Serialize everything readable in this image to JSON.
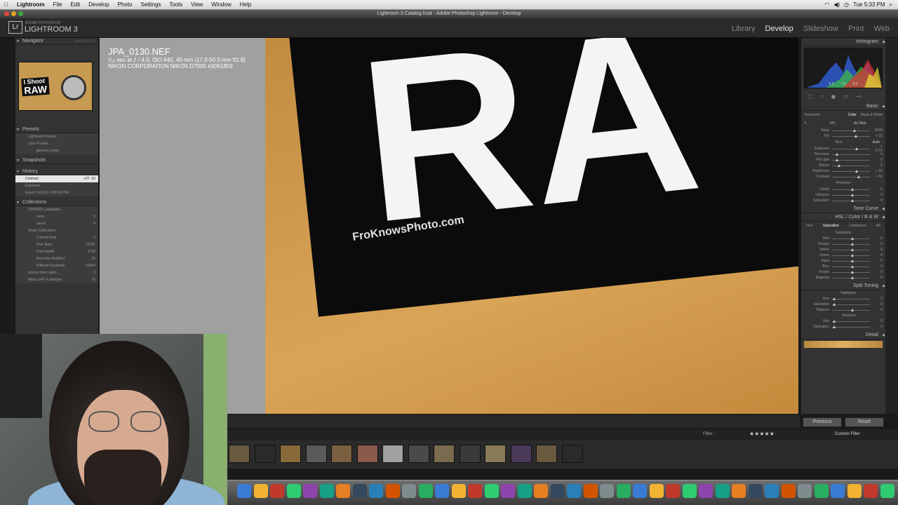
{
  "menubar": {
    "apple": "",
    "items": [
      "Lightroom",
      "File",
      "Edit",
      "Develop",
      "Photo",
      "Settings",
      "Tools",
      "View",
      "Window",
      "Help"
    ],
    "clock": "Tue 5:33 PM"
  },
  "window": {
    "title": "Lightroom 3 Catalog.lrcat - Adobe Photoshop Lightroom - Develop"
  },
  "lr": {
    "logo": "Lr",
    "brand_sub": "ADOBE PHOTOSHOP",
    "brand": "LIGHTROOM 3",
    "modules": [
      "Library",
      "Develop",
      "Slideshow",
      "Print",
      "Web"
    ],
    "active_module": "Develop"
  },
  "left": {
    "navigator": "Navigator",
    "nav_zoom": [
      "FIT",
      "FILL",
      "1:1",
      "3:1"
    ],
    "thumb_text": [
      "I Shoot",
      "RAW"
    ],
    "presets": "Presets",
    "preset_items": [
      "Lightroom Presets",
      "User Presets",
      "general_sharp"
    ],
    "snapshots": "Snapshots",
    "history": "History",
    "history_items": [
      {
        "name": "Contrast",
        "a": "+27",
        "b": "52"
      },
      {
        "name": "Exposure",
        "a": "",
        "b": ""
      },
      {
        "name": "Import (2/16/11 4:08:38 PM)",
        "a": "",
        "b": ""
      }
    ],
    "collections": "Collections",
    "collection_items": [
      {
        "name": "20090822_pasquale...",
        "count": ""
      },
      {
        "name": "Greg",
        "count": "0"
      },
      {
        "name": "Jared",
        "count": "0"
      },
      {
        "name": "Smart Collections",
        "count": ""
      },
      {
        "name": "Colored Red",
        "count": "0"
      },
      {
        "name": "Five Stars",
        "count": "16761"
      },
      {
        "name": "Past Month",
        "count": "1730"
      },
      {
        "name": "Recently Modified",
        "count": "26"
      },
      {
        "name": "Without Keywords",
        "count": "23424"
      },
      {
        "name": "photos from Lightr...",
        "count": "0"
      },
      {
        "name": "Nikon 24f1.4 samples",
        "count": "22"
      }
    ]
  },
  "photo": {
    "filename": "JPA_0130.NEF",
    "exposure": "¹⁄₅₀ sec at ƒ / 4.0, ISO 640, 40 mm (17.0-50.0 mm f/2.8)",
    "camera": "NIKON CORPORATION NIKON D7000 #3061859",
    "letters": "RA",
    "caption": "FroKnowsPhoto.com"
  },
  "right": {
    "histogram": "Histogram",
    "histo_vals": [
      "8.3",
      "7.6",
      "8.5"
    ],
    "basic": "Basic",
    "treatment": "Treatment:",
    "color": "Color",
    "bw": "Black & White",
    "wb": "WB :",
    "wb_val": "As Shot",
    "tone": "Tone",
    "auto": "Auto",
    "presence": "Presence",
    "sliders_basic": [
      {
        "name": "Temp",
        "val": "4600",
        "pos": 0.55
      },
      {
        "name": "Tint",
        "val": "+ 22",
        "pos": 0.6
      }
    ],
    "sliders_tone": [
      {
        "name": "Exposure",
        "val": "+ 0.75",
        "pos": 0.62
      },
      {
        "name": "Recovery",
        "val": "0",
        "pos": 0.1
      },
      {
        "name": "Fill Light",
        "val": "0",
        "pos": 0.1
      },
      {
        "name": "Blacks",
        "val": "5",
        "pos": 0.15
      },
      {
        "name": "Brightness",
        "val": "+ 50",
        "pos": 0.62
      },
      {
        "name": "Contrast",
        "val": "+ 52",
        "pos": 0.66
      }
    ],
    "sliders_presence": [
      {
        "name": "Clarity",
        "val": "0",
        "pos": 0.5
      },
      {
        "name": "Vibrance",
        "val": "0",
        "pos": 0.5
      },
      {
        "name": "Saturation",
        "val": "0",
        "pos": 0.5
      }
    ],
    "tone_curve": "Tone Curve",
    "hsl": "HSL",
    "hsl_color": "Color",
    "hsl_bw": "B & W",
    "hsl_tabs": [
      "Hue",
      "Saturation",
      "Luminance",
      "All"
    ],
    "saturation": "Saturation",
    "hsl_sliders": [
      {
        "name": "Red",
        "val": "0",
        "pos": 0.5
      },
      {
        "name": "Orange",
        "val": "0",
        "pos": 0.5
      },
      {
        "name": "Yellow",
        "val": "0",
        "pos": 0.5
      },
      {
        "name": "Green",
        "val": "0",
        "pos": 0.5
      },
      {
        "name": "Aqua",
        "val": "0",
        "pos": 0.5
      },
      {
        "name": "Blue",
        "val": "0",
        "pos": 0.5
      },
      {
        "name": "Purple",
        "val": "0",
        "pos": 0.5
      },
      {
        "name": "Magenta",
        "val": "0",
        "pos": 0.5
      }
    ],
    "split_toning": "Split Toning",
    "highlights": "Highlights",
    "shadows": "Shadows",
    "split_sliders_a": [
      {
        "name": "Hue",
        "val": "0",
        "pos": 0.02
      },
      {
        "name": "Saturation",
        "val": "0",
        "pos": 0.02
      }
    ],
    "balance": {
      "name": "Balance",
      "val": "0",
      "pos": 0.5
    },
    "split_sliders_b": [
      {
        "name": "Hue",
        "val": "0",
        "pos": 0.02
      },
      {
        "name": "Saturation",
        "val": "0",
        "pos": 0.02
      }
    ],
    "detail": "Detail",
    "previous": "Previous",
    "reset": "Reset"
  },
  "filmstrip": {
    "filter": "Filter :",
    "custom_filter": "Custom Filter",
    "stars": "★★★★★"
  }
}
